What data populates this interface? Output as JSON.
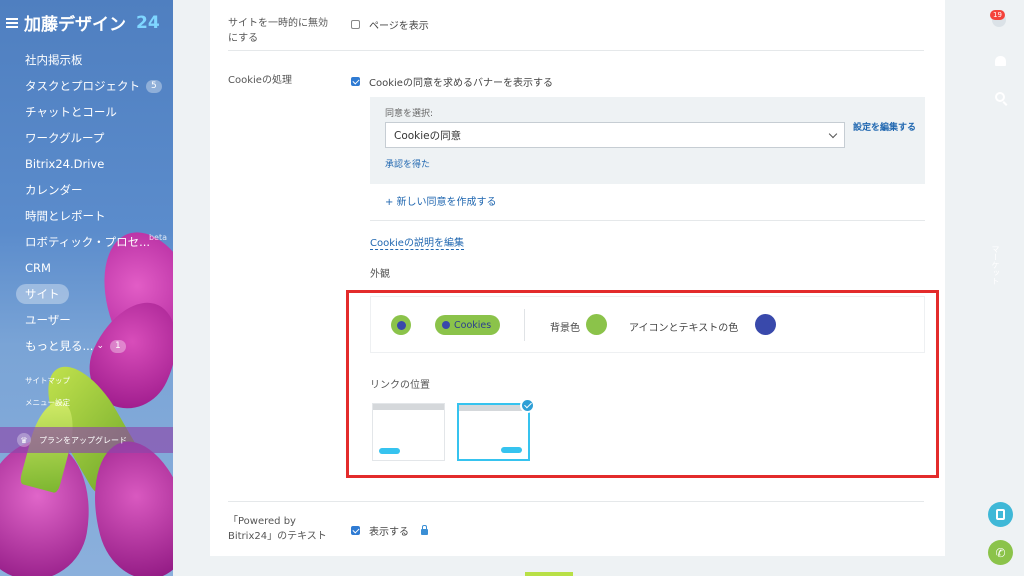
{
  "sidebar": {
    "logo_text": "加藤デザイン",
    "logo_number": "24",
    "items": [
      {
        "label": "社内掲示板"
      },
      {
        "label": "タスクとプロジェクト",
        "count": "5"
      },
      {
        "label": "チャットとコール"
      },
      {
        "label": "ワークグループ"
      },
      {
        "label": "Bitrix24.Drive"
      },
      {
        "label": "カレンダー"
      },
      {
        "label": "時間とレポート"
      },
      {
        "label": "ロボティック・プロセ...",
        "badge": "beta"
      },
      {
        "label": "CRM"
      },
      {
        "label": "サイト"
      },
      {
        "label": "ユーザー"
      },
      {
        "label": "もっと見る...",
        "count": "1"
      }
    ],
    "sitemap_label": "サイトマップ",
    "menu_settings_label": "メニュー設定",
    "upgrade_label": "プランをアップグレード"
  },
  "settings": {
    "disable_site_label": "サイトを一時的に無効にする",
    "show_page_label": "ページを表示",
    "cookie_label": "Cookieの処理",
    "cookie_banner_label": "Cookieの同意を求めるバナーを表示する",
    "select_consent_label": "同意を選択:",
    "consent_value": "Cookieの同意",
    "edit_settings_link": "設定を編集する",
    "approved_link": "承認を得た",
    "new_consent_link": "+ 新しい同意を作成する",
    "edit_description_link": "Cookieの説明を編集",
    "appearance_label": "外観",
    "cookies_pill_text": "Cookies",
    "background_color_label": "背景色",
    "icon_text_color_label": "アイコンとテキストの色",
    "link_position_label": "リンクの位置",
    "powered_by_label": "「Powered by Bitrix24」のテキスト",
    "show_label": "表示する"
  },
  "colors": {
    "background_color": "#8bc34a",
    "icon_text_color": "#3949ab",
    "highlight": "#e32b2b"
  },
  "right_panel": {
    "notification_count": "19",
    "vertical_text": "マーケット"
  }
}
